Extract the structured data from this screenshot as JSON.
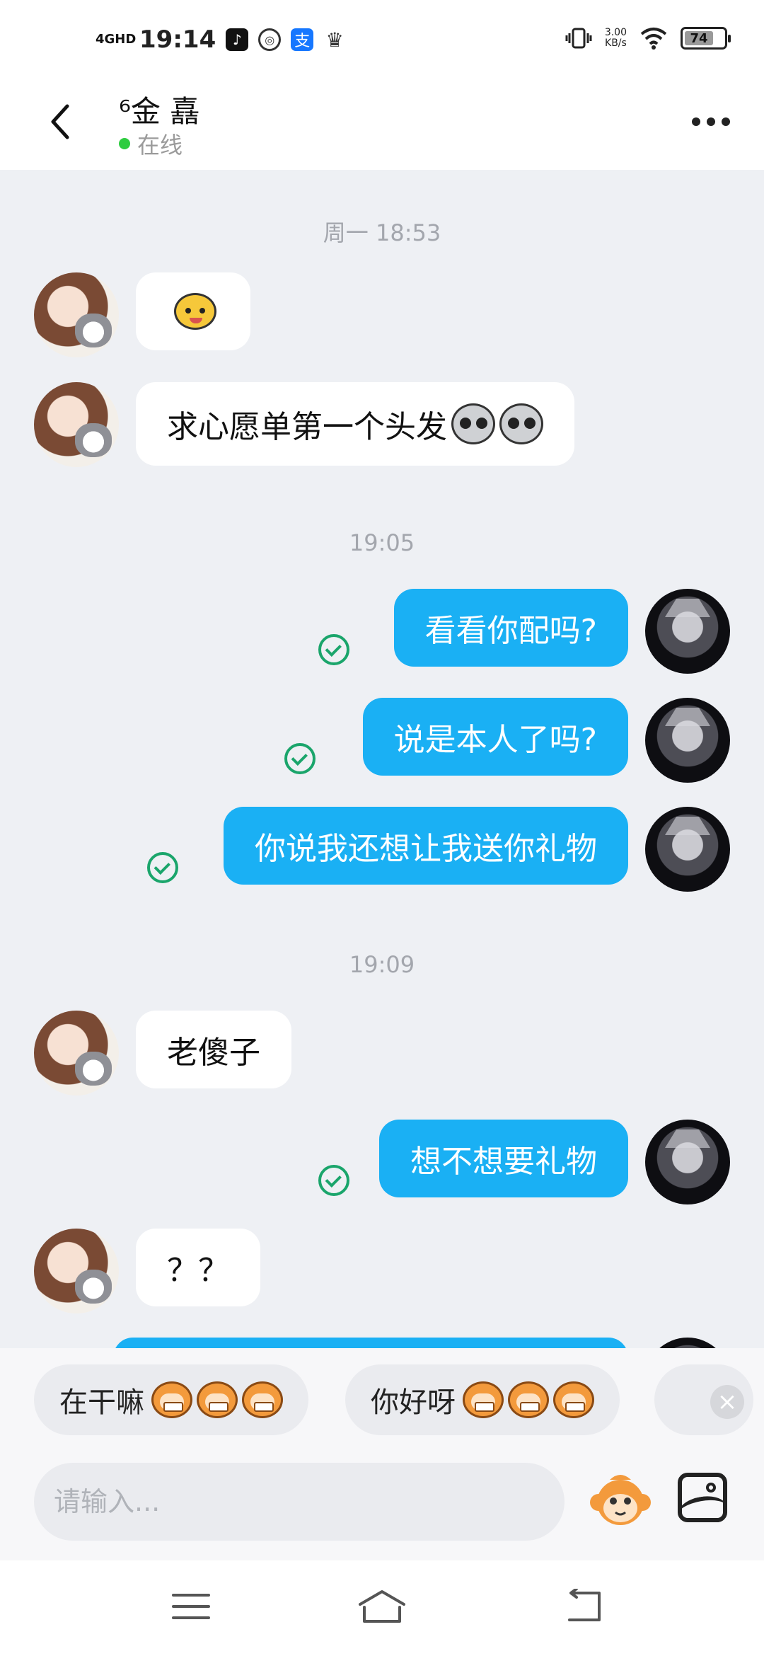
{
  "status_bar": {
    "network": "4GHD",
    "time": "19:14",
    "speed_value": "3.00",
    "speed_unit": "KB/s",
    "battery": "74",
    "apps": [
      "douyin-icon",
      "weibo-icon",
      "alipay-icon",
      "crown-icon"
    ]
  },
  "header": {
    "contact_name": "⁶金 嚞",
    "status": "在线"
  },
  "chat": {
    "timestamps": [
      "周一 18:53",
      "19:05",
      "19:09"
    ],
    "messages": [
      {
        "side": "in",
        "text": "",
        "emoji": "yellow-face"
      },
      {
        "side": "in",
        "text": "求心愿单第一个头发",
        "emoji": "gray-face x2"
      },
      {
        "side": "out",
        "text": "看看你配吗?",
        "read": true
      },
      {
        "side": "out",
        "text": "说是本人了吗?",
        "read": true
      },
      {
        "side": "out",
        "text": "你说我还想让我送你礼物",
        "read": true
      },
      {
        "side": "in",
        "text": "老傻子"
      },
      {
        "side": "out",
        "text": "想不想要礼物",
        "read": true
      },
      {
        "side": "in",
        "text": "？？"
      }
    ]
  },
  "quick_replies": [
    {
      "text": "在干嘛",
      "emoji": "grinning-monkey"
    },
    {
      "text": "你好呀",
      "emoji": "happy-monkey"
    }
  ],
  "input": {
    "placeholder": "请输入..."
  },
  "colors": {
    "outgoing_bubble": "#1ab0f4",
    "incoming_bubble": "#ffffff",
    "chat_background": "#eef0f4",
    "online": "#2ecc40",
    "read_check": "#1aa56b"
  }
}
